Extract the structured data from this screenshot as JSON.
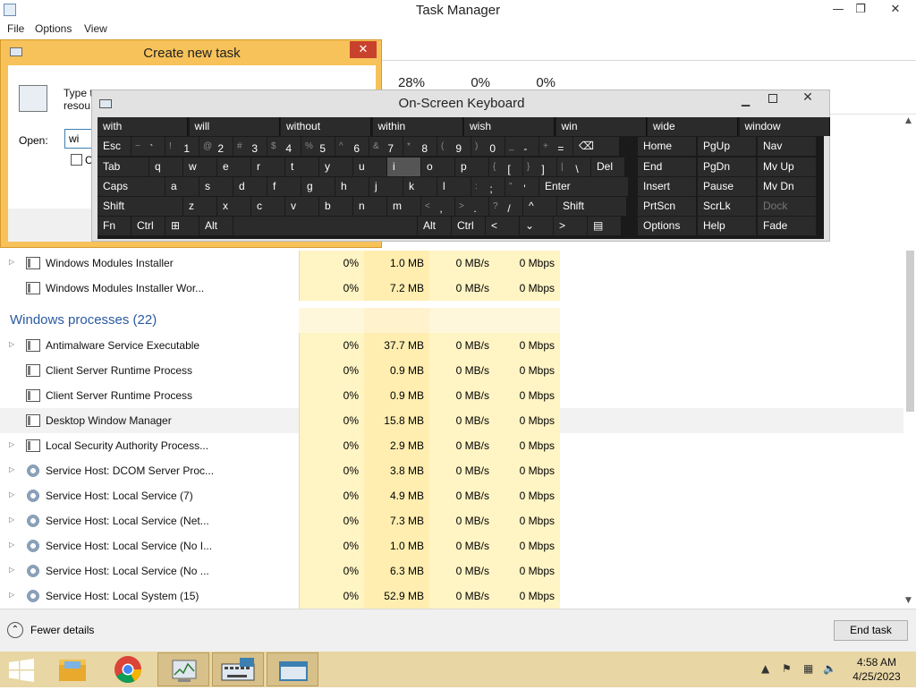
{
  "window": {
    "title": "Task Manager",
    "minimize": "—",
    "restore": "❐",
    "close": "✕"
  },
  "menu": [
    "File",
    "Options",
    "View"
  ],
  "stats": {
    "cpu": "28%",
    "memory": "0%",
    "disk": "0%"
  },
  "rows_top": [
    {
      "name": "Windows Modules Installer",
      "cpu": "0%",
      "mem": "1.0 MB",
      "disk": "0 MB/s",
      "net": "0 Mbps",
      "expand": true,
      "icon": "app-icon"
    },
    {
      "name": "Windows Modules Installer Wor...",
      "cpu": "0%",
      "mem": "7.2 MB",
      "disk": "0 MB/s",
      "net": "0 Mbps",
      "expand": false,
      "icon": "app-icon"
    }
  ],
  "group": {
    "label": "Windows processes (22)"
  },
  "rows": [
    {
      "name": "Antimalware Service Executable",
      "cpu": "0%",
      "mem": "37.7 MB",
      "disk": "0 MB/s",
      "net": "0 Mbps",
      "expand": true,
      "icon": "app-icon"
    },
    {
      "name": "Client Server Runtime Process",
      "cpu": "0%",
      "mem": "0.9 MB",
      "disk": "0 MB/s",
      "net": "0 Mbps",
      "expand": false,
      "icon": "app-icon"
    },
    {
      "name": "Client Server Runtime Process",
      "cpu": "0%",
      "mem": "0.9 MB",
      "disk": "0 MB/s",
      "net": "0 Mbps",
      "expand": false,
      "icon": "app-icon"
    },
    {
      "name": "Desktop Window Manager",
      "cpu": "0%",
      "mem": "15.8 MB",
      "disk": "0 MB/s",
      "net": "0 Mbps",
      "expand": false,
      "icon": "app-icon",
      "selected": true
    },
    {
      "name": "Local Security Authority Process...",
      "cpu": "0%",
      "mem": "2.9 MB",
      "disk": "0 MB/s",
      "net": "0 Mbps",
      "expand": true,
      "icon": "app-icon"
    },
    {
      "name": "Service Host: DCOM Server Proc...",
      "cpu": "0%",
      "mem": "3.8 MB",
      "disk": "0 MB/s",
      "net": "0 Mbps",
      "expand": true,
      "icon": "gear-icon"
    },
    {
      "name": "Service Host: Local Service (7)",
      "cpu": "0%",
      "mem": "4.9 MB",
      "disk": "0 MB/s",
      "net": "0 Mbps",
      "expand": true,
      "icon": "gear-icon"
    },
    {
      "name": "Service Host: Local Service (Net...",
      "cpu": "0%",
      "mem": "7.3 MB",
      "disk": "0 MB/s",
      "net": "0 Mbps",
      "expand": true,
      "icon": "gear-icon"
    },
    {
      "name": "Service Host: Local Service (No I...",
      "cpu": "0%",
      "mem": "1.0 MB",
      "disk": "0 MB/s",
      "net": "0 Mbps",
      "expand": true,
      "icon": "gear-icon"
    },
    {
      "name": "Service Host: Local Service (No ...",
      "cpu": "0%",
      "mem": "6.3 MB",
      "disk": "0 MB/s",
      "net": "0 Mbps",
      "expand": true,
      "icon": "gear-icon"
    },
    {
      "name": "Service Host: Local System (15)",
      "cpu": "0%",
      "mem": "52.9 MB",
      "disk": "0 MB/s",
      "net": "0 Mbps",
      "expand": true,
      "icon": "gear-icon"
    }
  ],
  "footer": {
    "fewer_details": "Fewer details",
    "end_task": "End task"
  },
  "dialog": {
    "title": "Create new task",
    "close": "✕",
    "description": "Type the name of a program, folder, document, or Internet resource",
    "desc_line1": "Type t",
    "desc_line2": "resou",
    "open_label": "Open:",
    "open_value": "wi",
    "checkbox_label": "C"
  },
  "osk": {
    "title": "On-Screen Keyboard",
    "close": "✕",
    "predictions": [
      "with",
      "will",
      "without",
      "within",
      "wish",
      "win",
      "wide",
      "window"
    ],
    "rows": [
      [
        {
          "t": "Esc"
        },
        {
          "s": "~",
          "t": "`"
        },
        {
          "s": "!",
          "t": "1"
        },
        {
          "s": "@",
          "t": "2"
        },
        {
          "s": "#",
          "t": "3"
        },
        {
          "s": "$",
          "t": "4"
        },
        {
          "s": "%",
          "t": "5"
        },
        {
          "s": "^",
          "t": "6"
        },
        {
          "s": "&",
          "t": "7"
        },
        {
          "s": "*",
          "t": "8"
        },
        {
          "s": "(",
          "t": "9"
        },
        {
          "s": ")",
          "t": "0"
        },
        {
          "s": "_",
          "t": "-"
        },
        {
          "s": "+",
          "t": "="
        },
        {
          "t": "⌫",
          "n": "backspace"
        }
      ],
      [
        {
          "t": "Tab"
        },
        {
          "t": "q"
        },
        {
          "t": "w"
        },
        {
          "t": "e"
        },
        {
          "t": "r"
        },
        {
          "t": "t"
        },
        {
          "t": "y"
        },
        {
          "t": "u"
        },
        {
          "t": "i"
        },
        {
          "t": "o"
        },
        {
          "t": "p"
        },
        {
          "s": "{",
          "t": "["
        },
        {
          "s": "}",
          "t": "]"
        },
        {
          "s": "|",
          "t": "\\"
        },
        {
          "t": "Del"
        }
      ],
      [
        {
          "t": "Caps"
        },
        {
          "t": "a"
        },
        {
          "t": "s"
        },
        {
          "t": "d"
        },
        {
          "t": "f"
        },
        {
          "t": "g"
        },
        {
          "t": "h"
        },
        {
          "t": "j"
        },
        {
          "t": "k"
        },
        {
          "t": "l"
        },
        {
          "s": ":",
          "t": ";"
        },
        {
          "s": "\"",
          "t": "'"
        },
        {
          "t": "Enter"
        }
      ],
      [
        {
          "t": "Shift"
        },
        {
          "t": "z"
        },
        {
          "t": "x"
        },
        {
          "t": "c"
        },
        {
          "t": "v"
        },
        {
          "t": "b"
        },
        {
          "t": "n"
        },
        {
          "t": "m"
        },
        {
          "s": "<",
          "t": ","
        },
        {
          "s": ">",
          "t": "."
        },
        {
          "s": "?",
          "t": "/"
        },
        {
          "t": "^"
        },
        {
          "t": "Shift"
        }
      ],
      [
        {
          "t": "Fn"
        },
        {
          "t": "Ctrl"
        },
        {
          "t": "⊞",
          "n": "windows"
        },
        {
          "t": "Alt"
        },
        {
          "t": "",
          "n": "space"
        },
        {
          "t": "Alt"
        },
        {
          "t": "Ctrl"
        },
        {
          "t": "<"
        },
        {
          "t": "⌄"
        },
        {
          "t": ">"
        },
        {
          "t": "▤",
          "n": "menu"
        }
      ]
    ],
    "nav": [
      [
        "Home",
        "PgUp",
        "Nav"
      ],
      [
        "End",
        "PgDn",
        "Mv Up"
      ],
      [
        "Insert",
        "Pause",
        "Mv Dn"
      ],
      [
        "PrtScn",
        "ScrLk",
        "Dock"
      ],
      [
        "Options",
        "Help",
        "Fade"
      ]
    ]
  },
  "taskbar": {
    "items": [
      "file-explorer-icon",
      "chrome-icon",
      "task-manager-icon",
      "on-screen-keyboard-icon",
      "run-dialog-icon"
    ],
    "time": "4:58 AM",
    "date": "4/25/2023"
  },
  "colors": {
    "accent": "#f7c25a",
    "heat": "#fff4c4",
    "taskbar": "#e8d6a4",
    "group": "#2a5aa0"
  }
}
